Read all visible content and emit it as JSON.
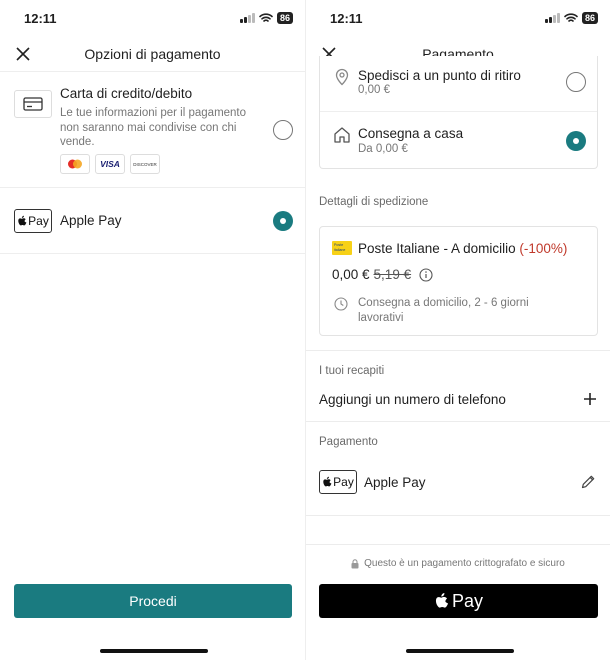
{
  "status": {
    "time": "12:11",
    "battery": "86"
  },
  "left": {
    "title": "Opzioni di pagamento",
    "card_option": {
      "label": "Carta di credito/debito",
      "description_line1": "Le tue informazioni per il pagamento",
      "description_line2": "non saranno mai condivise con chi",
      "description_line3": "vende.",
      "brands": [
        "mastercard",
        "VISA",
        "DISCOVER"
      ]
    },
    "apple_option": {
      "badge": "Pay",
      "label": "Apple Pay",
      "selected": true
    },
    "proceed_label": "Procedi",
    "accent": "#1a7b80"
  },
  "right": {
    "title": "Pagamento",
    "delivery": {
      "pickup_label": "Spedisci a un punto di ritiro",
      "pickup_price": "0,00 €",
      "home_label": "Consegna a casa",
      "home_price": "Da 0,00 €"
    },
    "shipping_section": "Dettagli di spedizione",
    "carrier": {
      "logo_text": "Poste italiane",
      "name": "Poste Italiane - A domicilio",
      "discount": "(-100%)",
      "price": "0,00 €",
      "old_price": "5,19 €",
      "eta_line1": "Consegna a domicilio, 2 - 6 giorni",
      "eta_line2": "lavorativi"
    },
    "contacts_section": "I tuoi recapiti",
    "add_phone": "Aggiungi un numero di telefono",
    "payment_section": "Pagamento",
    "payment_badge": "Pay",
    "payment_label": "Apple Pay",
    "secure_note": "Questo è un pagamento crittografato e sicuro",
    "apple_pay_button": "Pay",
    "discount_color": "#c0392b"
  }
}
